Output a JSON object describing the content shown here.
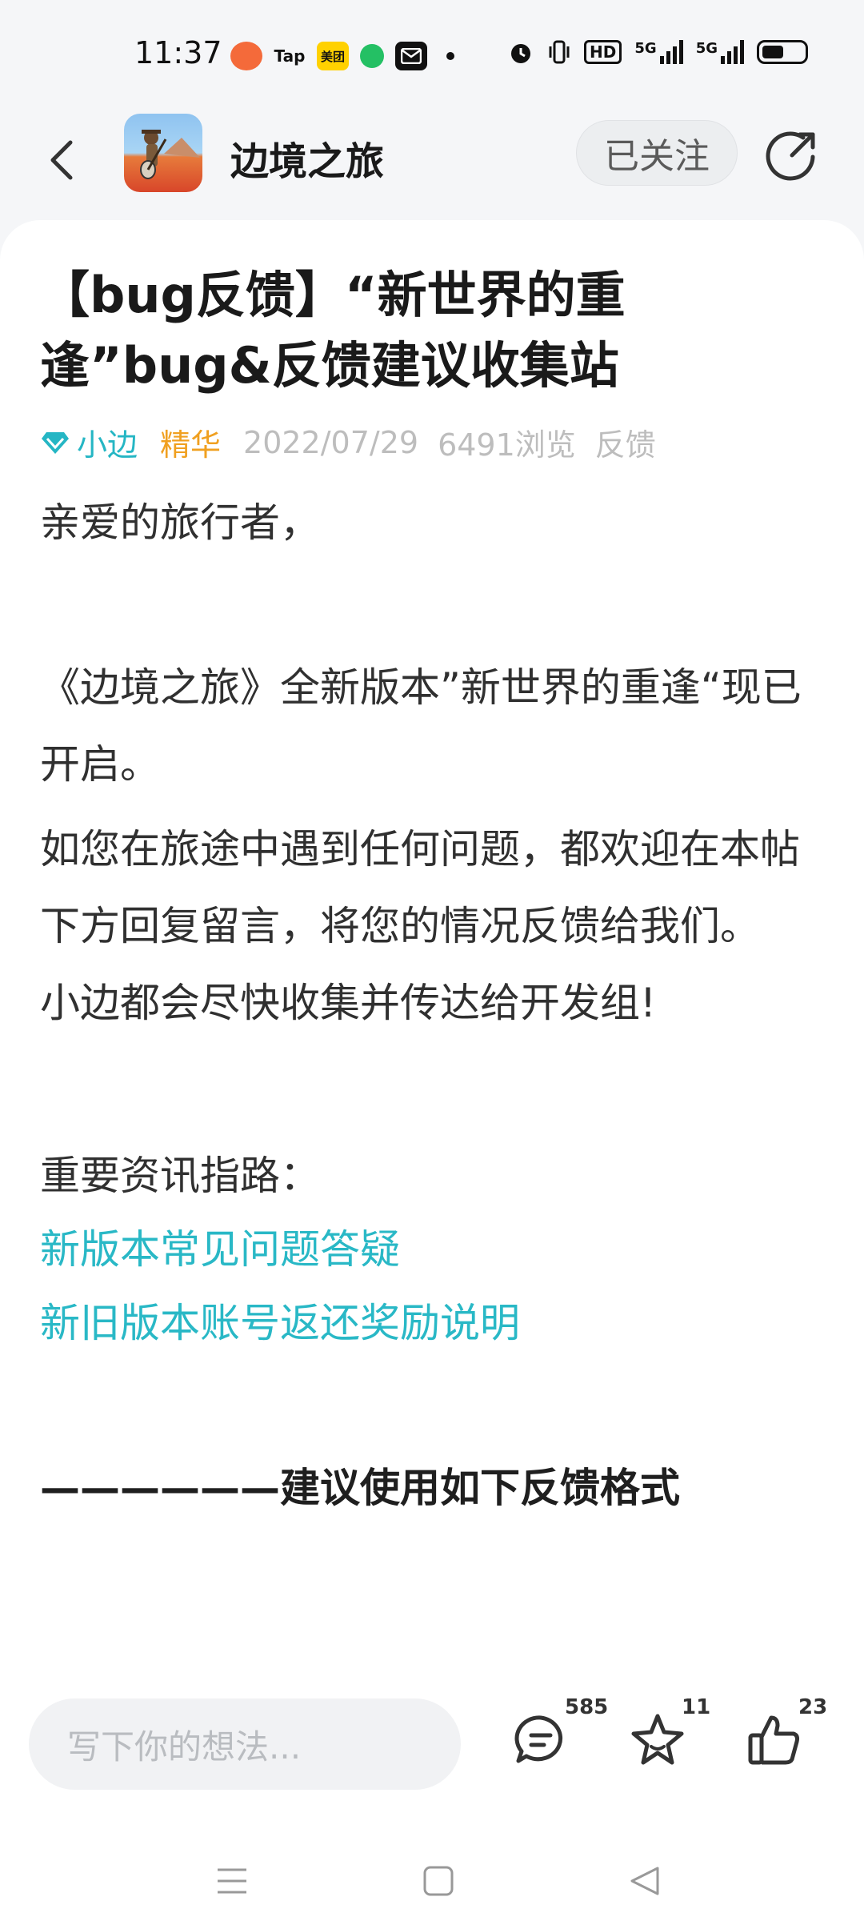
{
  "status_bar": {
    "time": "11:37",
    "app_icons": [
      {
        "name": "game-app-icon",
        "label": "",
        "color": "#f46a3a"
      },
      {
        "name": "taptap-icon",
        "label": "Tap",
        "color": "#ffffff"
      },
      {
        "name": "meituan-icon",
        "label": "美团",
        "color": "#ffd100"
      },
      {
        "name": "chat-bubble-icon",
        "label": "",
        "color": "#24c064"
      },
      {
        "name": "mail-icon",
        "label": "",
        "color": "#111111"
      }
    ],
    "network_5g_a": "5G",
    "network_5g_b": "5G",
    "hd_label": "HD"
  },
  "header": {
    "game_name": "边境之旅",
    "follow_label": "已关注"
  },
  "post": {
    "title": "【bug反馈】“新世界的重逢”bug&反馈建议收集站",
    "author": "小边",
    "tag": "精华",
    "date": "2022/07/29",
    "views": "6491浏览",
    "category": "反馈",
    "greeting": "亲爱的旅行者，",
    "para1": "《边境之旅》全新版本”新世界的重逢“现已开启。",
    "para2": "如您在旅途中遇到任何问题，都欢迎在本帖下方回复留言，将您的情况反馈给我们。",
    "para3": "小边都会尽快收集并传达给开发组!",
    "guide_heading": "重要资讯指路：",
    "link1": "新版本常见问题答疑",
    "link2": "新旧版本账号返还奖励说明",
    "format_heading": "——————建议使用如下反馈格式"
  },
  "bottom_bar": {
    "input_placeholder": "写下你的想法...",
    "comment_count": "585",
    "favorite_count": "11",
    "like_count": "23"
  },
  "colors": {
    "accent": "#29b8c6",
    "featured": "#f0a020",
    "meta_gray": "#bdbdbd"
  }
}
